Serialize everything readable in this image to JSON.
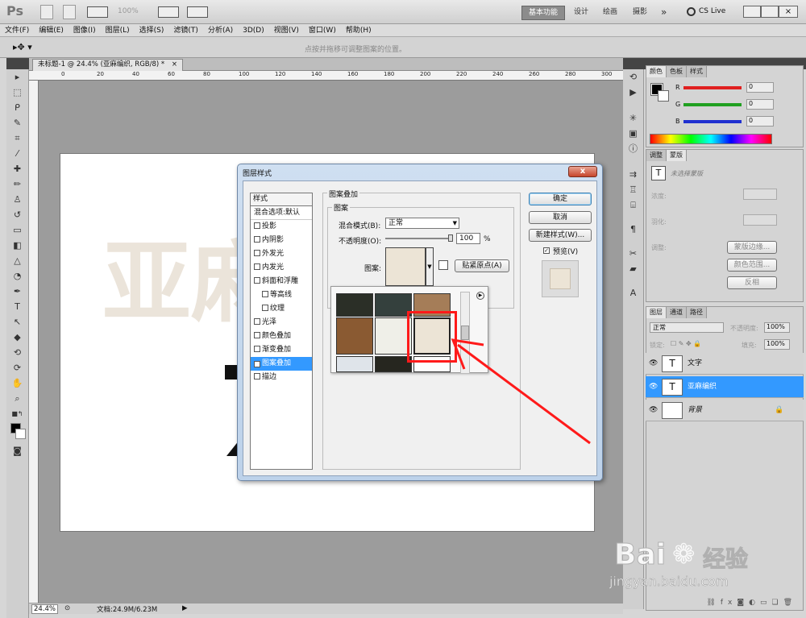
{
  "app": {
    "logo": "Ps",
    "zoom_combo": "100%",
    "workspaces": [
      "基本功能",
      "设计",
      "绘画",
      "摄影"
    ],
    "more": "»",
    "cs_live": "CS Live"
  },
  "menu": [
    "文件(F)",
    "编辑(E)",
    "图像(I)",
    "图层(L)",
    "选择(S)",
    "滤镜(T)",
    "分析(A)",
    "3D(D)",
    "视图(V)",
    "窗口(W)",
    "帮助(H)"
  ],
  "options_bar": {
    "hint": "点按并拖移可调整图案的位置。"
  },
  "document": {
    "tab_title": "未标题-1 @ 24.4% (亚麻编织, RGB/8) *",
    "close": "×",
    "ruler_marks": [
      "0",
      "20",
      "40",
      "60",
      "80",
      "100",
      "120",
      "140",
      "160",
      "180",
      "200",
      "220",
      "240",
      "260",
      "280",
      "300"
    ],
    "canvas_text": "亚麻"
  },
  "status": {
    "zoom": "24.4%",
    "doc_size": "文档:24.9M/6.23M"
  },
  "dialog": {
    "title": "图层样式",
    "styles_header": "样式",
    "blend_options": "混合选项:默认",
    "effects": [
      {
        "label": "投影",
        "checked": false,
        "indent": false
      },
      {
        "label": "内阴影",
        "checked": false,
        "indent": false
      },
      {
        "label": "外发光",
        "checked": false,
        "indent": false
      },
      {
        "label": "内发光",
        "checked": false,
        "indent": false
      },
      {
        "label": "斜面和浮雕",
        "checked": false,
        "indent": false
      },
      {
        "label": "等高线",
        "checked": false,
        "indent": true
      },
      {
        "label": "纹理",
        "checked": false,
        "indent": true
      },
      {
        "label": "光泽",
        "checked": false,
        "indent": false
      },
      {
        "label": "颜色叠加",
        "checked": false,
        "indent": false
      },
      {
        "label": "渐变叠加",
        "checked": false,
        "indent": false
      },
      {
        "label": "图案叠加",
        "checked": true,
        "indent": false,
        "selected": true
      },
      {
        "label": "描边",
        "checked": false,
        "indent": false
      }
    ],
    "group_title": "图案叠加",
    "subgroup_title": "图案",
    "blend_mode_label": "混合模式(B):",
    "blend_mode_value": "正常",
    "opacity_label": "不透明度(O):",
    "opacity_value": "100",
    "opacity_unit": "%",
    "pattern_label": "图案:",
    "snap_origin": "贴紧原点(A)",
    "buttons": {
      "ok": "确定",
      "cancel": "取消",
      "new_style": "新建样式(W)...",
      "preview": "预览(V)"
    },
    "preview_checked": true
  },
  "swatches": [
    "#2b2f27",
    "#34403d",
    "#a57d58",
    "#8a5a32",
    "#efefe8",
    "#ece4d6",
    "#dfe4ea",
    "#26261f",
    "#fdfdfd"
  ],
  "color_panel": {
    "tabs": [
      "颜色",
      "色板",
      "样式"
    ],
    "channels": [
      {
        "label": "R",
        "value": "0",
        "color": "#e02020"
      },
      {
        "label": "G",
        "value": "0",
        "color": "#20a020"
      },
      {
        "label": "B",
        "value": "0",
        "color": "#2030d0"
      }
    ]
  },
  "adjust_panel": {
    "tabs": [
      "调整",
      "蒙版"
    ],
    "header": "未选择蒙版",
    "density": "浓度:",
    "feather": "羽化:",
    "refine": "调整:",
    "mask_edge": "蒙版边缘...",
    "color_range": "颜色范围...",
    "invert": "反相"
  },
  "layers_panel": {
    "tabs": [
      "图层",
      "通道",
      "路径"
    ],
    "blend": "正常",
    "opacity_label": "不透明度:",
    "opacity": "100%",
    "lock_label": "锁定:",
    "fill_label": "填充:",
    "fill": "100%",
    "layers": [
      {
        "name": "文字",
        "thumb": "T",
        "selected": false
      },
      {
        "name": "亚麻编织",
        "thumb": "T",
        "selected": true
      },
      {
        "name": "背景",
        "thumb": "",
        "selected": false
      }
    ],
    "footer_icons": [
      "link",
      "fx",
      "mask",
      "adjust",
      "folder",
      "new",
      "trash"
    ]
  },
  "watermark": {
    "brand": "Bai",
    "brand2": "经验",
    "url": "jingyan.baidu.com"
  }
}
